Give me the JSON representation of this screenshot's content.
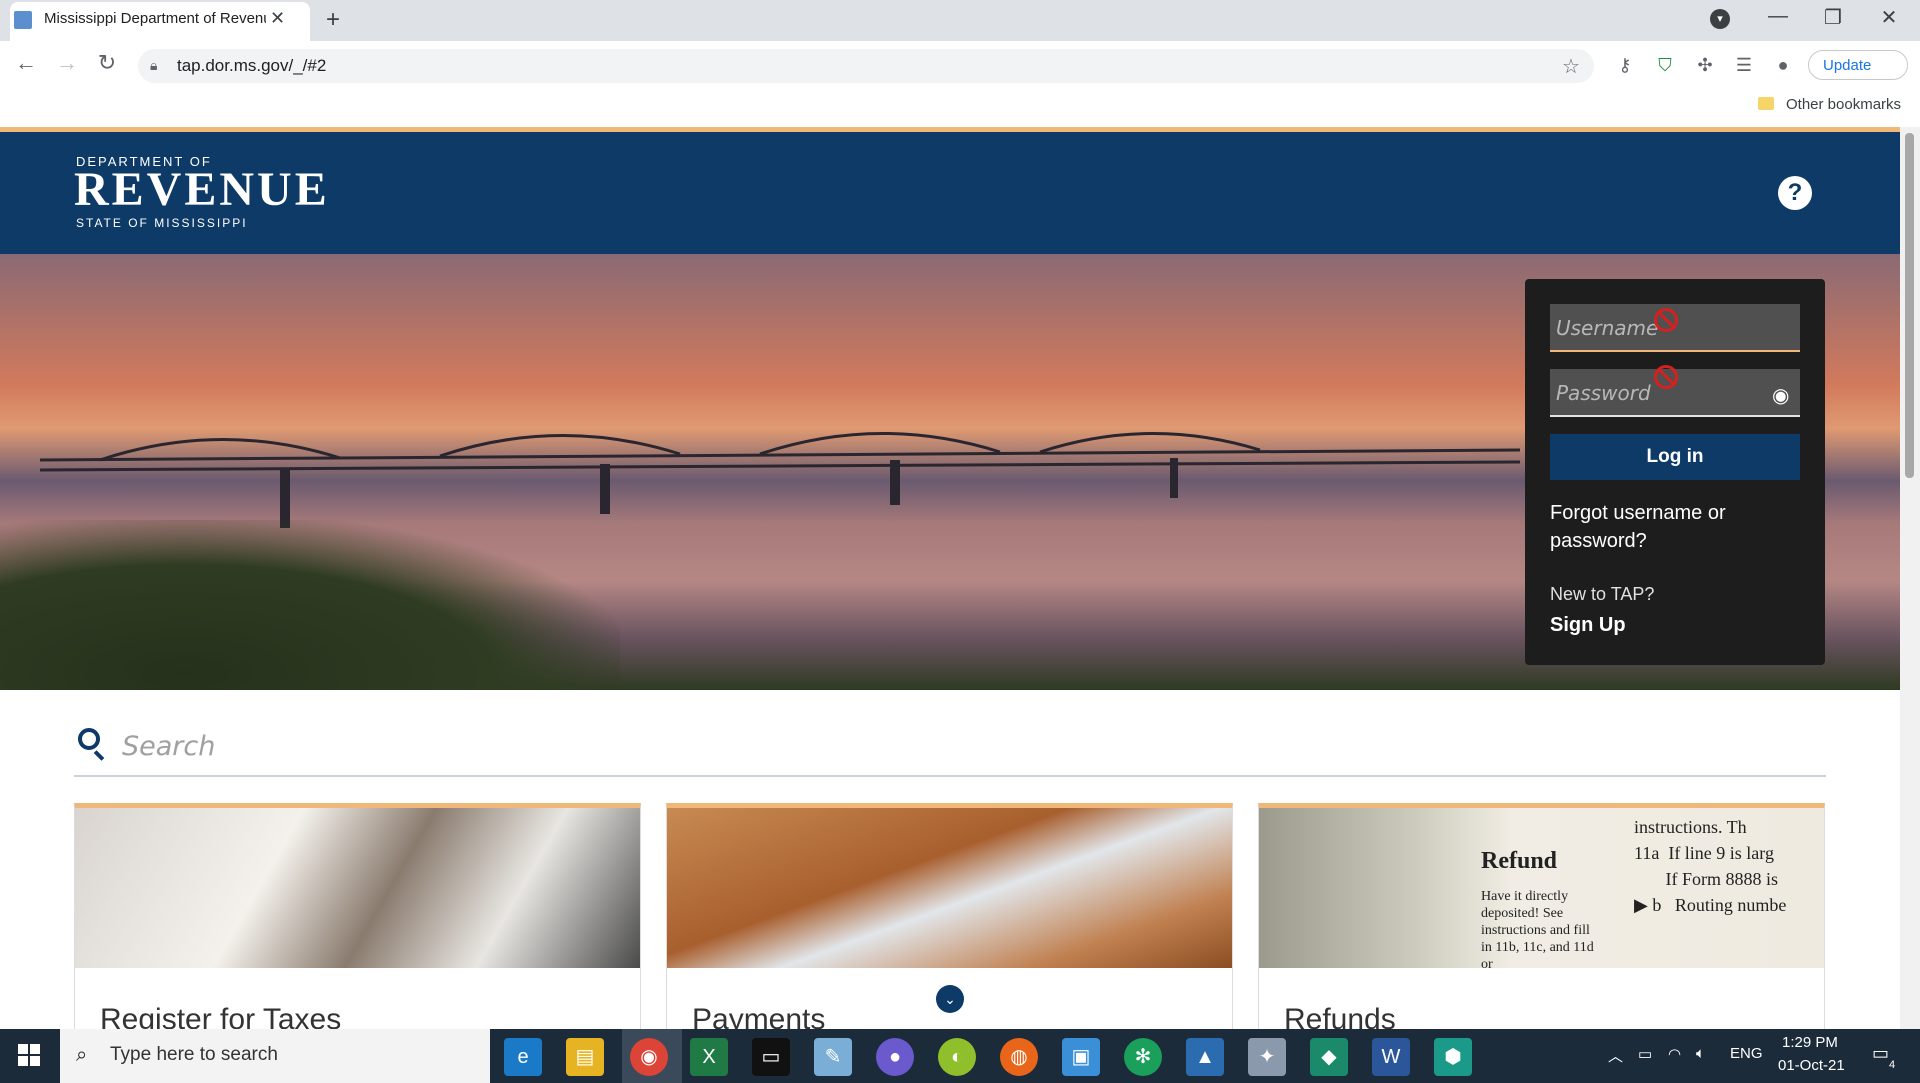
{
  "browser": {
    "tab_title": "Mississippi Department of Revenue",
    "url": "tap.dor.ms.gov/_/#2",
    "update_label": "Update",
    "bookmarks_folder": "Other bookmarks"
  },
  "header": {
    "logo_top": "DEPARTMENT OF",
    "logo_main": "REVENUE",
    "logo_sub": "STATE OF MISSISSIPPI",
    "help": "?"
  },
  "login": {
    "username_placeholder": "Username",
    "password_placeholder": "Password",
    "login_label": "Log in",
    "forgot_label": "Forgot username or password?",
    "new_label": "New to TAP?",
    "signup_label": "Sign Up"
  },
  "search": {
    "placeholder": "Search"
  },
  "cards": [
    {
      "title": "Register for Taxes"
    },
    {
      "title": "Payments"
    },
    {
      "title": "Refunds"
    }
  ],
  "refund_image": {
    "heading": "Refund",
    "body": "Have it directly deposited! See instructions and fill in 11b, 11c, and 11d or",
    "side": "instructions. Th\n11a  If line 9 is larg\n       If Form 8888 is\n▶ b   Routing numbe"
  },
  "taskbar": {
    "search_placeholder": "Type here to search",
    "language": "ENG",
    "time": "1:29 PM",
    "date": "01-Oct-21",
    "notifications": "4"
  },
  "colors": {
    "brand_navy": "#0d3a66",
    "accent_orange": "#f0b878",
    "login_panel": "#1d1d1d"
  }
}
